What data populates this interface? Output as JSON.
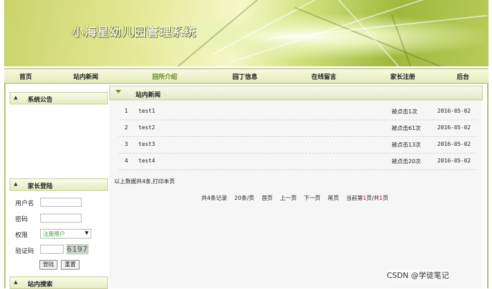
{
  "banner": {
    "title": "小海星幼儿园管理系统"
  },
  "nav": {
    "items": [
      "首页",
      "站内新闻",
      "园所介绍",
      "园丁信息",
      "在线留言",
      "家长注册",
      "后台"
    ],
    "active": "园所介绍"
  },
  "sidebar": {
    "announcement_title": "系统公告",
    "login_title": "家长登陆",
    "username_label": "用户名",
    "password_label": "密码",
    "role_label": "权限",
    "role_value": "注册用户",
    "captcha_label": "验证码",
    "captcha_text": "6197",
    "login_button": "登陆",
    "reset_button": "重置",
    "search_title": "站内搜索"
  },
  "main": {
    "section_title": "站内新闻",
    "news": [
      {
        "num": "1",
        "title": "test1",
        "clicks": "被点击1次",
        "date": "2016-05-02"
      },
      {
        "num": "2",
        "title": "test2",
        "clicks": "被点击61次",
        "date": "2016-05-02"
      },
      {
        "num": "3",
        "title": "test3",
        "clicks": "被点击13次",
        "date": "2016-05-02"
      },
      {
        "num": "4",
        "title": "test4",
        "clicks": "被点击20次",
        "date": "2016-05-02"
      }
    ],
    "summary_text": "以上数据共4条,",
    "print_label": "打印本页",
    "pager": {
      "total": "共4条记录",
      "per_page": "20条/页",
      "first": "首页",
      "prev": "上一页",
      "next": "下一页",
      "last": "尾页",
      "current_prefix": "当前第",
      "current_page": "1",
      "current_mid": "页/共",
      "total_pages": "1",
      "current_suffix": "页"
    }
  },
  "watermark": "CSDN @学徒笔记",
  "colors": {
    "nav_active": "#6b8e23",
    "frame": "#b6be6d",
    "banner_green": "#c9d46a"
  }
}
